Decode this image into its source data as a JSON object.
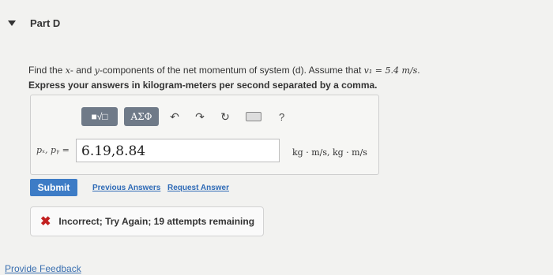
{
  "part": {
    "title": "Part D"
  },
  "question": {
    "text_1": "Find the ",
    "x": "x",
    "text_2": "- and ",
    "y": "y",
    "text_3": "-components of the net momentum of system (d). Assume that ",
    "assumption": "v₁ = 5.4 m/s",
    "text_4": "."
  },
  "instruction": "Express your answers in kilogram-meters per second separated by a comma.",
  "toolbar": {
    "templates_label": "■√□",
    "greek_label": "ΑΣΦ",
    "undo_glyph": "↶",
    "redo_glyph": "↷",
    "reset_glyph": "↻",
    "help_glyph": "?"
  },
  "answer": {
    "label": "pₓ, pᵧ =",
    "value": "6.19,8.84",
    "units": "kg · m/s, kg · m/s"
  },
  "actions": {
    "submit": "Submit",
    "previous": "Previous Answers",
    "request": "Request Answer"
  },
  "feedback": {
    "icon": "✖",
    "text": "Incorrect; Try Again; 19 attempts remaining",
    "color": "#c21f1f"
  },
  "footer": {
    "provide_feedback": "Provide Feedback"
  }
}
